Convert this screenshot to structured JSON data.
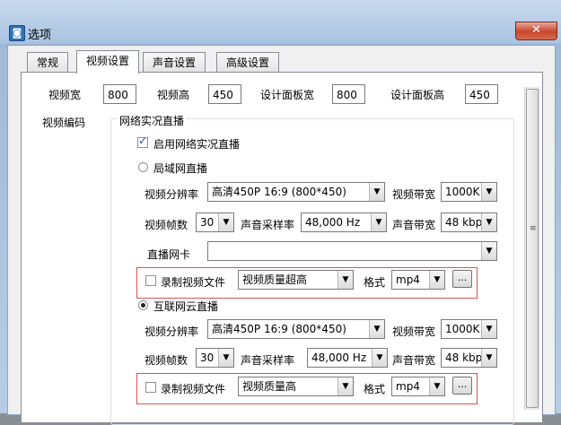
{
  "window": {
    "title": "选项",
    "app_icon": "app-icon",
    "close_label": "✕"
  },
  "tabs": [
    {
      "label": "常规"
    },
    {
      "label": "视频设置",
      "active": true
    },
    {
      "label": "声音设置"
    },
    {
      "label": "高级设置"
    }
  ],
  "size": {
    "video_width_label": "视频宽",
    "video_width": "800",
    "video_height_label": "视频高",
    "video_height": "450",
    "design_width_label": "设计面板宽",
    "design_width": "800",
    "design_height_label": "设计面板高",
    "design_height": "450"
  },
  "video_encoding_label": "视频编码",
  "group": {
    "title": "网络实况直播",
    "enable_label": "启用网络实况直播",
    "enable_checked": true,
    "lan": {
      "label": "局域网直播",
      "resolution_label": "视频分辨率",
      "resolution": "高清450P 16:9 (800*450)",
      "bandwidth_label": "视频带宽",
      "bandwidth": "1000K",
      "fps_label": "视频帧数",
      "fps": "30",
      "samplerate_label": "声音采样率",
      "samplerate": "48,000 Hz",
      "audio_bw_label": "声音带宽",
      "audio_bw": "48 kbps",
      "nic_label": "直播网卡",
      "nic": "",
      "record_label": "录制视频文件",
      "quality": "视频质量超高",
      "format_label": "格式",
      "format": "mp4",
      "browse": "..."
    },
    "internet": {
      "label": "互联网云直播",
      "resolution_label": "视频分辨率",
      "resolution": "高清450P 16:9 (800*450)",
      "bandwidth_label": "视频带宽",
      "bandwidth": "1000K",
      "fps_label": "视频帧数",
      "fps": "30",
      "samplerate_label": "声音采样率",
      "samplerate": "48,000 Hz",
      "audio_bw_label": "声音带宽",
      "audio_bw": "48 kbps",
      "record_label": "录制视频文件",
      "quality": "视频质量高",
      "format_label": "格式",
      "format": "mp4",
      "browse": "..."
    }
  },
  "colors": {
    "highlight_box": "#d9534f",
    "window_frame": "#b9d1ea"
  }
}
